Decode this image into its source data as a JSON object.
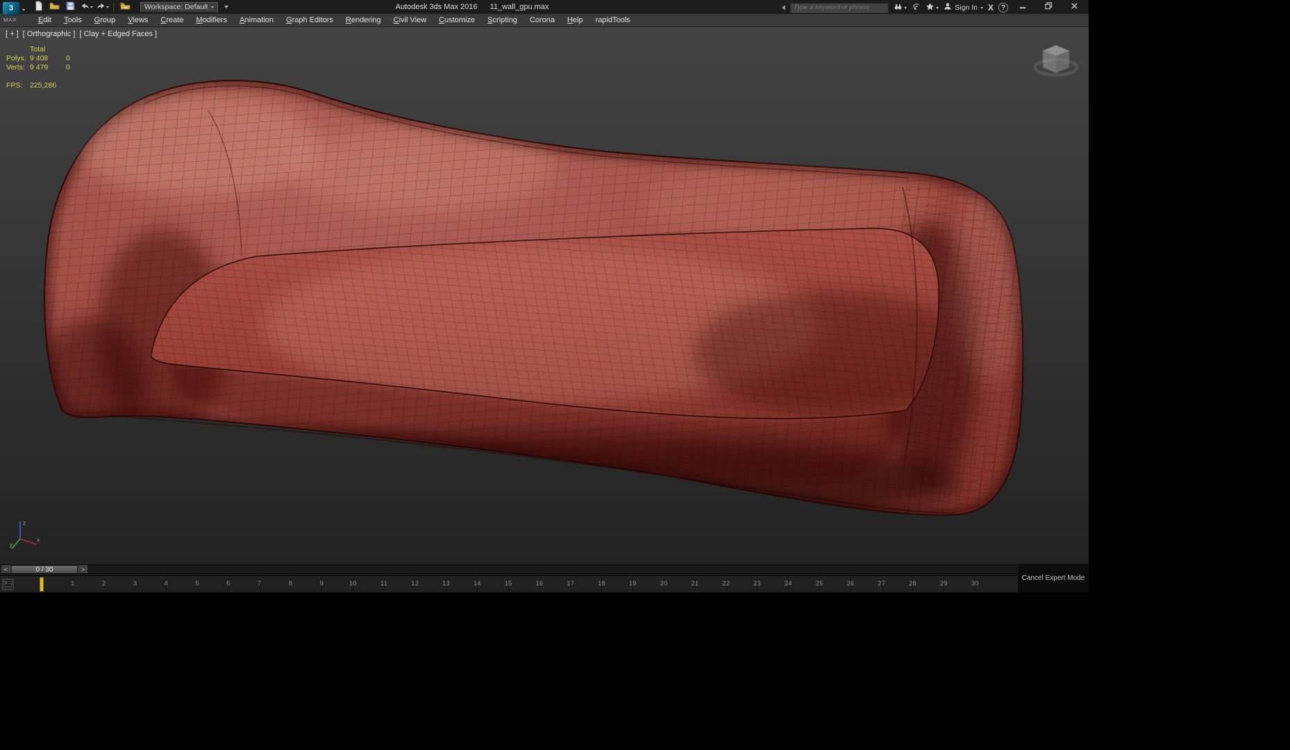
{
  "app": {
    "logo_text": "MAX",
    "title_app": "Autodesk 3ds Max 2016",
    "title_file": "11_wall_gpu.max",
    "workspace_label": "Workspace: Default",
    "sign_in_label": "Sign In",
    "search_placeholder": "Type a keyword or phrase",
    "help_glyph": "?",
    "exchange_glyph": "X"
  },
  "icons": {
    "new_scene": "blank-page",
    "open_file": "folder",
    "save_file": "floppy-disk",
    "undo": "curved-arrow-left",
    "redo": "curved-arrow-right",
    "project_folder": "folder-arrow",
    "infocenter_search": "binoculars",
    "communication_center": "satellite-dish",
    "favorites": "star",
    "sign_in": "person",
    "minimize": "underscore",
    "restore": "overlapping-squares",
    "close": "x-cross"
  },
  "menu": {
    "items": [
      {
        "label": "Edit",
        "u": 0
      },
      {
        "label": "Tools",
        "u": 0
      },
      {
        "label": "Group",
        "u": 0
      },
      {
        "label": "Views",
        "u": 0
      },
      {
        "label": "Create",
        "u": 0
      },
      {
        "label": "Modifiers",
        "u": 0
      },
      {
        "label": "Animation",
        "u": 0
      },
      {
        "label": "Graph Editors",
        "u": 0
      },
      {
        "label": "Rendering",
        "u": 0
      },
      {
        "label": "Civil View",
        "u": 0
      },
      {
        "label": "Customize",
        "u": 0
      },
      {
        "label": "Scripting",
        "u": 0
      },
      {
        "label": "Corona",
        "u": null
      },
      {
        "label": "Help",
        "u": 0
      },
      {
        "label": "rapidTools",
        "u": null
      }
    ]
  },
  "viewport": {
    "label": {
      "general": "[ + ]",
      "pov": "[ Orthographic ]",
      "shading": "[ Clay + Edged Faces ]"
    },
    "stats": {
      "header": "Total",
      "rows": [
        {
          "label": "Polys:",
          "value": "9 408",
          "delta": "0"
        },
        {
          "label": "Verts:",
          "value": "9 479",
          "delta": "0"
        }
      ],
      "fps_label": "FPS:",
      "fps_value": "225,286"
    },
    "axis": {
      "x": "x",
      "y": "y",
      "z": "z"
    }
  },
  "timeline": {
    "prev_glyph": "<",
    "frame_display": "0 / 30",
    "next_glyph": ">",
    "current_frame": 0,
    "tick_labels": [
      "1",
      "2",
      "3",
      "4",
      "5",
      "6",
      "7",
      "8",
      "9",
      "10",
      "11",
      "12",
      "13",
      "14",
      "15",
      "16",
      "17",
      "18",
      "19",
      "20",
      "21",
      "22",
      "23",
      "24",
      "25",
      "26",
      "27",
      "28",
      "29",
      "30"
    ],
    "cancel_expert_label": "Cancel Expert Mode"
  },
  "colors": {
    "couch_base": "#9e4a40",
    "couch_shadow": "#6e241f",
    "stats_text": "#d4d45a",
    "current_frame_marker": "#d8c428",
    "viewport_bg_top": "#434343",
    "viewport_bg_bottom": "#232323"
  }
}
